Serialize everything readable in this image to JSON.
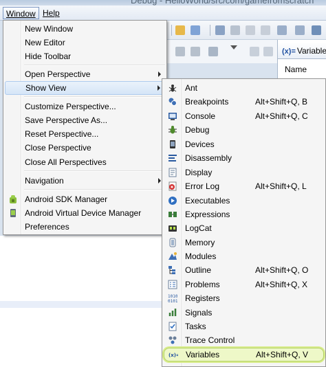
{
  "title_strip": "Debug - HelloWorld/src/com/gamefromscratch",
  "menubar": {
    "window": "Window",
    "help": "Help"
  },
  "background": {
    "variables_tab": "Variables",
    "name_column": "Name"
  },
  "window_menu": {
    "items": [
      {
        "label": "New Window"
      },
      {
        "label": "New Editor"
      },
      {
        "label": "Hide Toolbar"
      },
      {
        "label": "Open Perspective"
      },
      {
        "label": "Show View"
      },
      {
        "label": "Customize Perspective..."
      },
      {
        "label": "Save Perspective As..."
      },
      {
        "label": "Reset Perspective..."
      },
      {
        "label": "Close Perspective"
      },
      {
        "label": "Close All Perspectives"
      },
      {
        "label": "Navigation"
      },
      {
        "label": "Android SDK Manager"
      },
      {
        "label": "Android Virtual Device Manager"
      },
      {
        "label": "Preferences"
      }
    ]
  },
  "show_view_menu": {
    "items": [
      {
        "label": "Ant",
        "shortcut": "",
        "icon": "ant-icon"
      },
      {
        "label": "Breakpoints",
        "shortcut": "Alt+Shift+Q, B",
        "icon": "breakpoints-icon"
      },
      {
        "label": "Console",
        "shortcut": "Alt+Shift+Q, C",
        "icon": "console-icon"
      },
      {
        "label": "Debug",
        "shortcut": "",
        "icon": "debug-icon"
      },
      {
        "label": "Devices",
        "shortcut": "",
        "icon": "devices-icon"
      },
      {
        "label": "Disassembly",
        "shortcut": "",
        "icon": "disassembly-icon"
      },
      {
        "label": "Display",
        "shortcut": "",
        "icon": "display-icon"
      },
      {
        "label": "Error Log",
        "shortcut": "Alt+Shift+Q, L",
        "icon": "error-log-icon"
      },
      {
        "label": "Executables",
        "shortcut": "",
        "icon": "executables-icon"
      },
      {
        "label": "Expressions",
        "shortcut": "",
        "icon": "expressions-icon"
      },
      {
        "label": "LogCat",
        "shortcut": "",
        "icon": "logcat-icon"
      },
      {
        "label": "Memory",
        "shortcut": "",
        "icon": "memory-icon"
      },
      {
        "label": "Modules",
        "shortcut": "",
        "icon": "modules-icon"
      },
      {
        "label": "Outline",
        "shortcut": "Alt+Shift+Q, O",
        "icon": "outline-icon"
      },
      {
        "label": "Problems",
        "shortcut": "Alt+Shift+Q, X",
        "icon": "problems-icon"
      },
      {
        "label": "Registers",
        "shortcut": "",
        "icon": "registers-icon"
      },
      {
        "label": "Signals",
        "shortcut": "",
        "icon": "signals-icon"
      },
      {
        "label": "Tasks",
        "shortcut": "",
        "icon": "tasks-icon"
      },
      {
        "label": "Trace Control",
        "shortcut": "",
        "icon": "trace-control-icon"
      },
      {
        "label": "Variables",
        "shortcut": "Alt+Shift+Q, V",
        "icon": "variables-icon"
      }
    ]
  },
  "colors": {
    "menu_background": "#f5f5f5",
    "hover_highlight": "#d5e5f7",
    "callout_highlight": "#eef8c8",
    "callout_border": "#b5d26a"
  }
}
